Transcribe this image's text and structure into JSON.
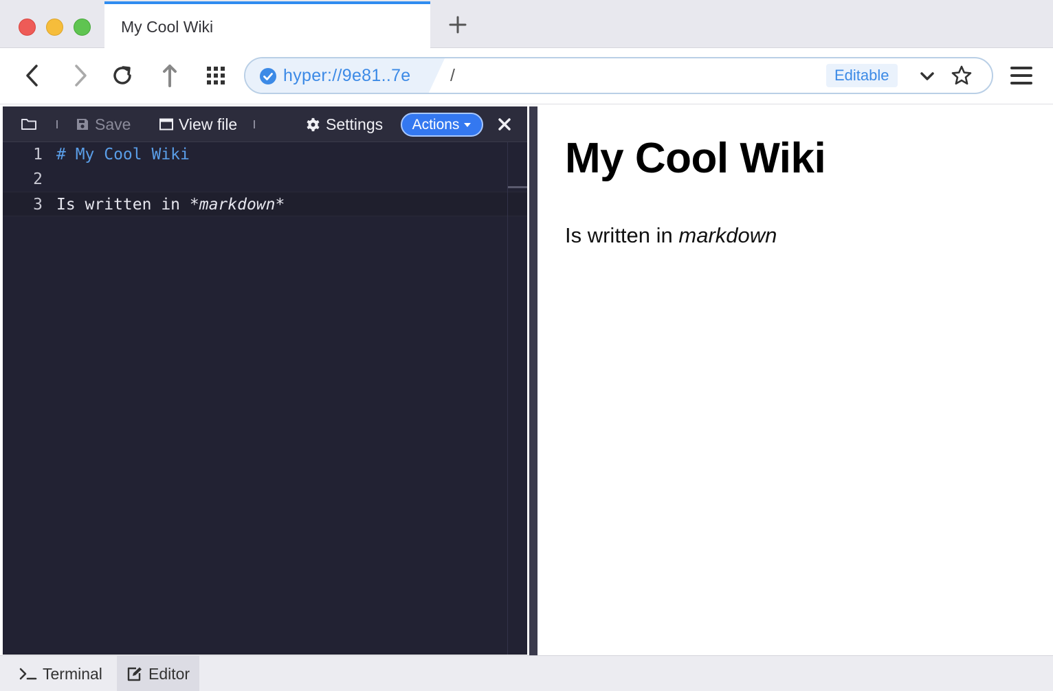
{
  "browser": {
    "tab_title": "My Cool Wiki",
    "url_host": "hyper://9e81..7e",
    "url_path": "/",
    "url_badge": "Editable"
  },
  "editor": {
    "toolbar": {
      "save_label": "Save",
      "view_file_label": "View file",
      "settings_label": "Settings",
      "actions_label": "Actions"
    },
    "lines": [
      {
        "number": "1",
        "text": "# My Cool Wiki"
      },
      {
        "number": "2",
        "text": ""
      },
      {
        "number": "3",
        "text_prefix": "Is written in ",
        "text_em": "*markdown*"
      }
    ]
  },
  "preview": {
    "heading": "My Cool Wiki",
    "paragraph_prefix": "Is written in ",
    "paragraph_em": "markdown"
  },
  "bottom_tabs": {
    "terminal_label": "Terminal",
    "editor_label": "Editor",
    "active": "Editor"
  },
  "colors": {
    "accent": "#3478f0",
    "tab_indicator": "#2f8cf0",
    "editor_bg": "#222233",
    "heading_syntax": "#5a9ee8"
  },
  "icons": [
    "folder-icon",
    "save-icon",
    "window-icon",
    "gear-icon",
    "caret-down-icon",
    "close-icon",
    "back-icon",
    "forward-icon",
    "reload-icon",
    "up-icon",
    "apps-grid-icon",
    "verified-check-icon",
    "chevron-down-icon",
    "star-icon",
    "hamburger-menu-icon",
    "terminal-icon",
    "edit-icon"
  ]
}
